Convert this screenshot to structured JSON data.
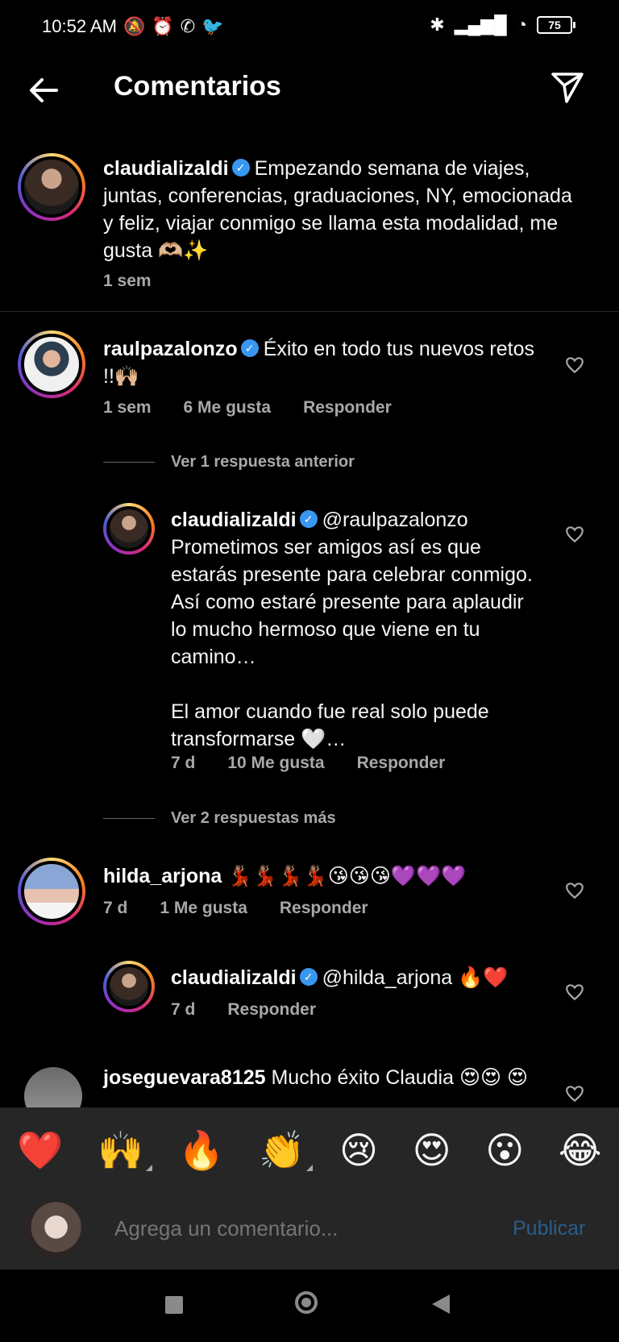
{
  "status_bar": {
    "time": "10:52 AM",
    "battery": "75"
  },
  "header": {
    "title": "Comentarios"
  },
  "caption": {
    "username": "claudializaldi",
    "text": "Empezando semana de viajes, juntas, conferencias, graduaciones, NY, emocionada y feliz, viajar conmigo se llama esta modalidad, me gusta 🫶🏼✨",
    "time": "1 sem"
  },
  "comments": [
    {
      "username": "raulpazalonzo",
      "text": "Éxito en todo tus nuevos retos !!🙌🏼",
      "time": "1 sem",
      "likes": "6 Me gusta",
      "reply_label": "Responder"
    }
  ],
  "view_previous": "Ver 1 respuesta anterior",
  "reply1": {
    "username": "claudializaldi",
    "mention": "@raulpazalonzo",
    "text_line1": "Prometimos ser amigos así es que estarás presente para celebrar conmigo. Así como estaré presente para aplaudir lo mucho hermoso que viene en tu camino…",
    "text_line2": "El amor cuando fue real solo puede transformarse 🤍…",
    "time": "7 d",
    "likes": "10 Me gusta",
    "reply_label": "Responder"
  },
  "view_more": "Ver 2 respuestas más",
  "comment2": {
    "username": "hilda_arjona",
    "text": "💃🏽💃🏽💃🏽💃🏽😘😘😘💜💜💜",
    "time": "7 d",
    "likes": "1 Me gusta",
    "reply_label": "Responder"
  },
  "reply2": {
    "username": "claudializaldi",
    "mention": "@hilda_arjona",
    "text": "🔥❤️",
    "time": "7 d",
    "reply_label": "Responder"
  },
  "comment3": {
    "username": "joseguevara8125",
    "text": "Mucho éxito Claudia 😍😍",
    "text_cont": "😍"
  },
  "emoji_bar": [
    "❤️",
    "🙌",
    "🔥",
    "👏",
    "😢",
    "😍",
    "😮",
    "😂"
  ],
  "composer": {
    "placeholder": "Agrega un comentario...",
    "publish_label": "Publicar"
  },
  "colors": {
    "accent_blue": "#3897f0",
    "publish_disabled": "#2a5d8a",
    "background": "#000000",
    "secondary_text": "#a8a8a8"
  }
}
